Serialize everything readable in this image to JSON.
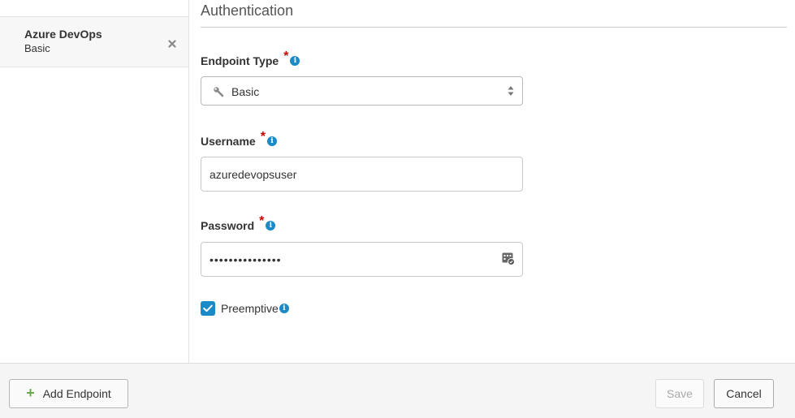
{
  "sidebar": {
    "items": [
      {
        "name": "Azure DevOps",
        "subtitle": "Basic",
        "remove_icon": "close-icon"
      }
    ]
  },
  "main": {
    "section_title": "Authentication",
    "endpoint_type": {
      "label": "Endpoint Type",
      "required_mark": "*",
      "info_glyph": "i",
      "value": "Basic",
      "value_icon": "wrench-icon"
    },
    "username": {
      "label": "Username",
      "required_mark": "*",
      "info_glyph": "i",
      "value": "azuredevopsuser"
    },
    "password": {
      "label": "Password",
      "required_mark": "*",
      "info_glyph": "i",
      "value": "•••••••••••••••",
      "icon": "password-manager-icon"
    },
    "preemptive": {
      "label": "Preemptive",
      "checked": true,
      "info_glyph": "i"
    }
  },
  "footer": {
    "add_endpoint_icon": "+",
    "add_endpoint_label": "Add Endpoint",
    "save_label": "Save",
    "cancel_label": "Cancel"
  },
  "colors": {
    "accent": "#1a8bc8",
    "required": "#cc0000",
    "add_icon": "#6aa84f"
  }
}
